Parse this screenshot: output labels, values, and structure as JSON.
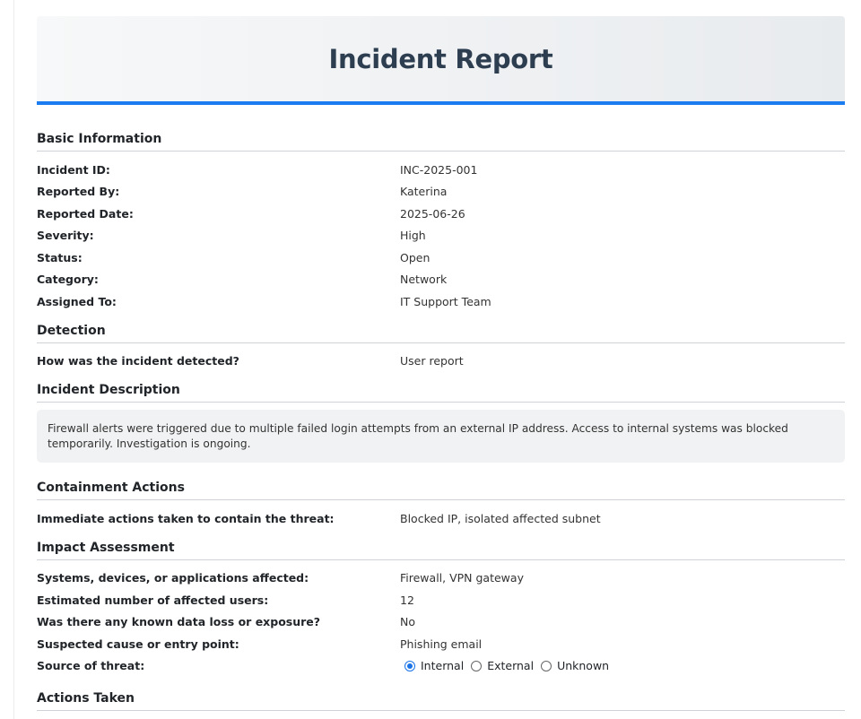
{
  "header": {
    "title": "Incident Report"
  },
  "basic_info": {
    "title": "Basic Information",
    "rows": [
      {
        "label": "Incident ID:",
        "value": "INC-2025-001"
      },
      {
        "label": "Reported By:",
        "value": "Katerina"
      },
      {
        "label": "Reported Date:",
        "value": "2025-06-26"
      },
      {
        "label": "Severity:",
        "value": "High"
      },
      {
        "label": "Status:",
        "value": "Open"
      },
      {
        "label": "Category:",
        "value": "Network"
      },
      {
        "label": "Assigned To:",
        "value": "IT Support Team"
      }
    ]
  },
  "detection": {
    "title": "Detection",
    "rows": [
      {
        "label": "How was the incident detected?",
        "value": "User report"
      }
    ]
  },
  "description": {
    "title": "Incident Description",
    "text": "Firewall alerts were triggered due to multiple failed login attempts from an external IP address. Access to internal systems was blocked temporarily. Investigation is ongoing."
  },
  "containment": {
    "title": "Containment Actions",
    "rows": [
      {
        "label": "Immediate actions taken to contain the threat:",
        "value": "Blocked IP, isolated affected subnet"
      }
    ]
  },
  "impact": {
    "title": "Impact Assessment",
    "rows": [
      {
        "label": "Systems, devices, or applications affected:",
        "value": "Firewall, VPN gateway"
      },
      {
        "label": "Estimated number of affected users:",
        "value": "12"
      },
      {
        "label": "Was there any known data loss or exposure?",
        "value": "No"
      },
      {
        "label": "Suspected cause or entry point:",
        "value": "Phishing email"
      }
    ],
    "source": {
      "label": "Source of threat:",
      "options": [
        "Internal",
        "External",
        "Unknown"
      ],
      "selected": "Internal"
    }
  },
  "actions_taken": {
    "title": "Actions Taken"
  }
}
